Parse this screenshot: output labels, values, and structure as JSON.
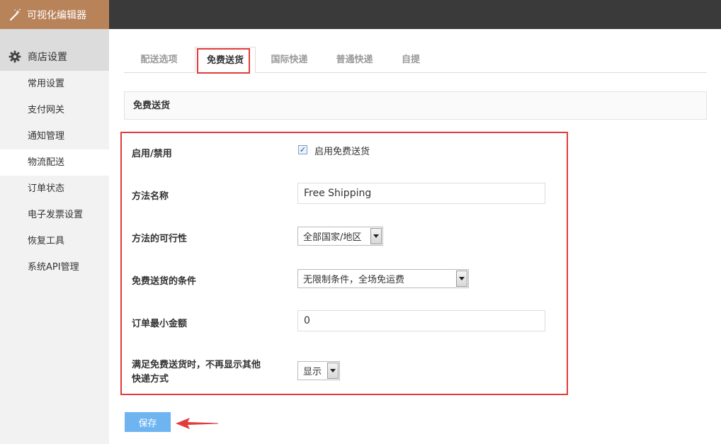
{
  "brand": {
    "title": "可视化编辑器",
    "icon": "magic-wand-icon"
  },
  "sidebar": {
    "header": "商店设置",
    "header_icon": "gear-icon",
    "items": [
      {
        "label": "常用设置"
      },
      {
        "label": "支付网关"
      },
      {
        "label": "通知管理"
      },
      {
        "label": "物流配送",
        "active": true
      },
      {
        "label": "订单状态"
      },
      {
        "label": "电子发票设置"
      },
      {
        "label": "恢复工具"
      },
      {
        "label": "系统API管理"
      }
    ]
  },
  "tabs": [
    {
      "label": "配送选项"
    },
    {
      "label": "免费送货",
      "active": true
    },
    {
      "label": "国际快递"
    },
    {
      "label": "普通快递"
    },
    {
      "label": "自提"
    }
  ],
  "section": {
    "title": "免费送货"
  },
  "form": {
    "enable": {
      "label": "启用/禁用",
      "checkbox_label": "启用免费送货",
      "checked": true
    },
    "method_name": {
      "label": "方法名称",
      "value": "Free Shipping"
    },
    "availability": {
      "label": "方法的可行性",
      "selected": "全部国家/地区"
    },
    "condition": {
      "label": "免费送货的条件",
      "selected": "无限制条件，全场免运费"
    },
    "min_amount": {
      "label": "订单最小金额",
      "value": "0"
    },
    "hide_others": {
      "label_line1": "满足免费送货时，不再显示其他",
      "label_line2": "快递方式",
      "selected": "显示"
    }
  },
  "save": {
    "label": "保存"
  },
  "colors": {
    "brand": "#b9835a",
    "topbar": "#3a3a3a",
    "highlight": "#e23b3b",
    "button": "#6eb4f0"
  }
}
